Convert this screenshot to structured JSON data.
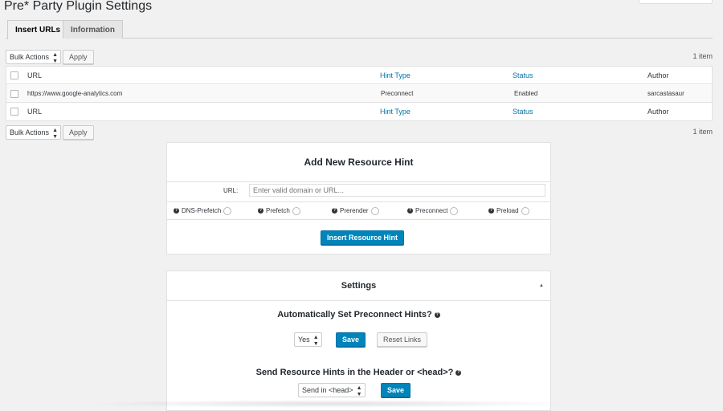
{
  "page": {
    "title": "Pre* Party Plugin Settings"
  },
  "tabs": [
    {
      "label": "Insert URLs",
      "active": true
    },
    {
      "label": "Information",
      "active": false
    }
  ],
  "bulk_actions": {
    "select_label": "Bulk Actions",
    "apply_label": "Apply",
    "item_count": "1 item"
  },
  "table": {
    "columns": {
      "url": "URL",
      "hint_type": "Hint Type",
      "status": "Status",
      "author": "Author"
    },
    "rows": [
      {
        "url": "https://www.google-analytics.com",
        "hint_type": "Preconnect",
        "status": "Enabled",
        "author": "sarcastasaur"
      }
    ]
  },
  "add_hint": {
    "title": "Add New Resource Hint",
    "url_label": "URL:",
    "url_placeholder": "Enter valid domain or URL...",
    "options": [
      "DNS-Prefetch",
      "Prefetch",
      "Prerender",
      "Preconnect",
      "Preload"
    ],
    "submit_label": "Insert Resource Hint"
  },
  "settings": {
    "title": "Settings",
    "preconnect_question": "Automatically Set Preconnect Hints?",
    "preconnect_value": "Yes",
    "save_label": "Save",
    "reset_label": "Reset Links",
    "header_question": "Send Resource Hints in the Header or <head>?",
    "header_value": "Send in <head>"
  },
  "colors": {
    "primary": "#0085ba",
    "link": "#0073aa",
    "background": "#f1f1f1"
  }
}
